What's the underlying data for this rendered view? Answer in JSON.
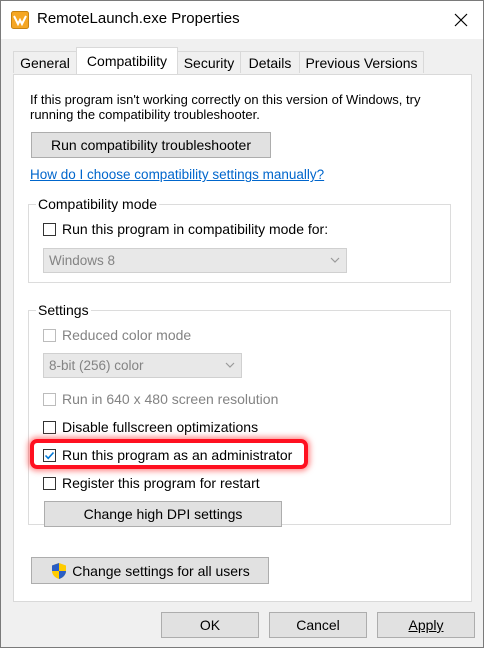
{
  "window": {
    "title": "RemoteLaunch.exe Properties",
    "app_icon": "application-icon",
    "close_icon": "close-icon"
  },
  "tabs": [
    {
      "label": "General",
      "active": false
    },
    {
      "label": "Compatibility",
      "active": true
    },
    {
      "label": "Security",
      "active": false
    },
    {
      "label": "Details",
      "active": false
    },
    {
      "label": "Previous Versions",
      "active": false
    }
  ],
  "compat": {
    "intro": "If this program isn't working correctly on this version of Windows, try running the compatibility troubleshooter.",
    "troubleshooter_button": "Run compatibility troubleshooter",
    "help_link": "How do I choose compatibility settings manually?",
    "mode_group_title": "Compatibility mode",
    "mode_checkbox_label": "Run this program in compatibility mode for:",
    "mode_checked": false,
    "mode_select_value": "Windows 8"
  },
  "settings": {
    "group_title": "Settings",
    "reduced_color_label": "Reduced color mode",
    "reduced_color_checked": false,
    "color_select_value": "8-bit (256) color",
    "res_640_label": "Run in 640 x 480 screen resolution",
    "res_640_checked": false,
    "fullscreen_opt_label": "Disable fullscreen optimizations",
    "fullscreen_opt_checked": false,
    "admin_label": "Run this program as an administrator",
    "admin_checked": true,
    "restart_label": "Register this program for restart",
    "restart_checked": false,
    "dpi_button": "Change high DPI settings"
  },
  "all_users_button": "Change settings for all users",
  "all_users_icon": "uac-shield-icon",
  "footer": {
    "ok": "OK",
    "cancel": "Cancel",
    "apply": "Apply"
  },
  "colors": {
    "highlight": "#ff1020",
    "link": "#0066cc",
    "check": "#0078d7"
  }
}
